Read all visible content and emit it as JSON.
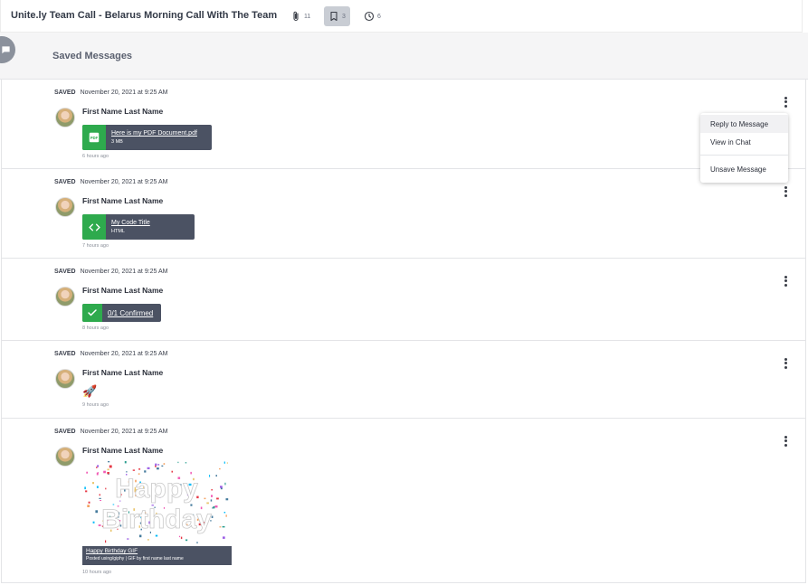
{
  "header": {
    "title": "Unite.ly Team Call - Belarus Morning Call With The Team",
    "attachments_count": "11",
    "saved_count": "3",
    "history_count": "6"
  },
  "subheader": {
    "title": "Saved Messages"
  },
  "messages": [
    {
      "status": "SAVED",
      "timestamp": "November 20, 2021 at 9:25 AM",
      "sender": "First Name Last Name",
      "attachment": {
        "type": "pdf",
        "name": "Here is my PDF Document.pdf",
        "detail": "3 MB"
      },
      "ago": "6 hours ago"
    },
    {
      "status": "SAVED",
      "timestamp": "November 20, 2021 at 9:25 AM",
      "sender": "First Name Last Name",
      "attachment": {
        "type": "code",
        "name": "My Code Title",
        "detail": "HTML"
      },
      "ago": "7 hours ago"
    },
    {
      "status": "SAVED",
      "timestamp": "November 20, 2021 at 9:25 AM",
      "sender": "First Name Last Name",
      "attachment": {
        "type": "confirm",
        "name": "0/1 Confirmed"
      },
      "ago": "8 hours ago"
    },
    {
      "status": "SAVED",
      "timestamp": "November 20, 2021 at 9:25 AM",
      "sender": "First Name Last Name",
      "emoji": "🚀",
      "ago": "9 hours ago"
    },
    {
      "status": "SAVED",
      "timestamp": "November 20, 2021 at 9:25 AM",
      "sender": "First Name Last Name",
      "gif": {
        "title": "Happy Birthday GIF",
        "caption": "Posted using/giphy | GIF by first name last name",
        "image_text_1": "Happy",
        "image_text_2": "Birthday"
      },
      "ago": "10 hours ago"
    }
  ],
  "menu": {
    "reply": "Reply to Message",
    "view": "View in Chat",
    "unsave": "Unsave Message"
  },
  "colors": {
    "accent_green": "#2eaa4d",
    "card_bg": "#4b5263"
  }
}
